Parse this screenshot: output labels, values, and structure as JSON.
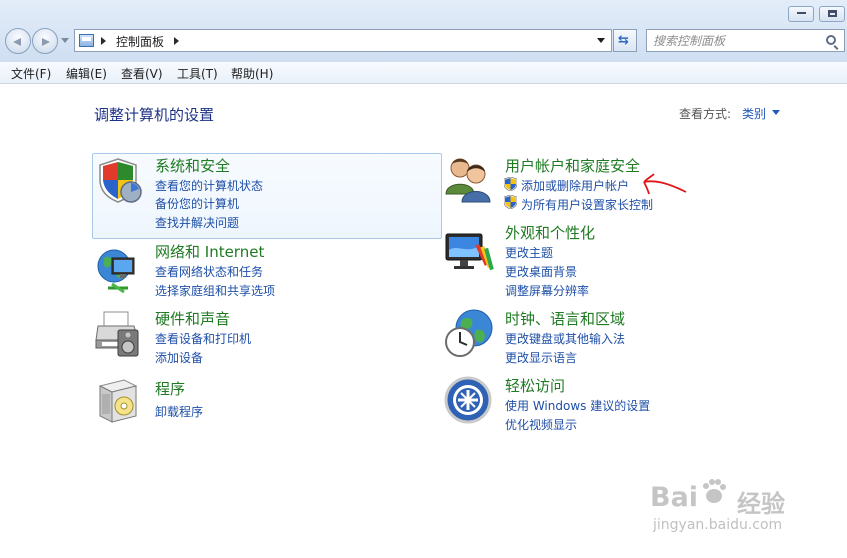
{
  "window": {
    "controls": [
      "minimize-button",
      "maximize-button"
    ]
  },
  "address_bar": {
    "crumb": "控制面板"
  },
  "search": {
    "placeholder": "搜索控制面板"
  },
  "menu": {
    "file": "文件(F)",
    "edit": "编辑(E)",
    "view": "查看(V)",
    "tools": "工具(T)",
    "help": "帮助(H)"
  },
  "header": {
    "title": "调整计算机的设置",
    "view_label": "查看方式:",
    "view_value": "类别"
  },
  "categories": {
    "system": {
      "title": "系统和安全",
      "links": [
        "查看您的计算机状态",
        "备份您的计算机",
        "查找并解决问题"
      ],
      "icon": "shield-icon"
    },
    "network": {
      "title": "网络和 Internet",
      "links": [
        "查看网络状态和任务",
        "选择家庭组和共享选项"
      ],
      "icon": "network-globe-icon"
    },
    "hardware": {
      "title": "硬件和声音",
      "links": [
        "查看设备和打印机",
        "添加设备"
      ],
      "icon": "printer-icon"
    },
    "programs": {
      "title": "程序",
      "links": [
        "卸载程序"
      ],
      "icon": "programs-box-icon"
    },
    "users": {
      "title": "用户帐户和家庭安全",
      "links": [
        "添加或删除用户帐户",
        "为所有用户设置家长控制"
      ],
      "icon": "users-icon"
    },
    "appearance": {
      "title": "外观和个性化",
      "links": [
        "更改主题",
        "更改桌面背景",
        "调整屏幕分辨率"
      ],
      "icon": "monitor-paint-icon"
    },
    "clock": {
      "title": "时钟、语言和区域",
      "links": [
        "更改键盘或其他输入法",
        "更改显示语言"
      ],
      "icon": "clock-globe-icon"
    },
    "ease": {
      "title": "轻松访问",
      "links": [
        "使用 Windows 建议的设置",
        "优化视频显示"
      ],
      "icon": "ease-of-access-icon"
    }
  },
  "watermark": {
    "logo": "Bai",
    "logo_cn": "经验",
    "url": "jingyan.baidu.com"
  },
  "colors": {
    "category_title": "#1f7a22",
    "link": "#1e4fa8",
    "page_title": "#1e3287",
    "annotation": "#e0151b"
  }
}
